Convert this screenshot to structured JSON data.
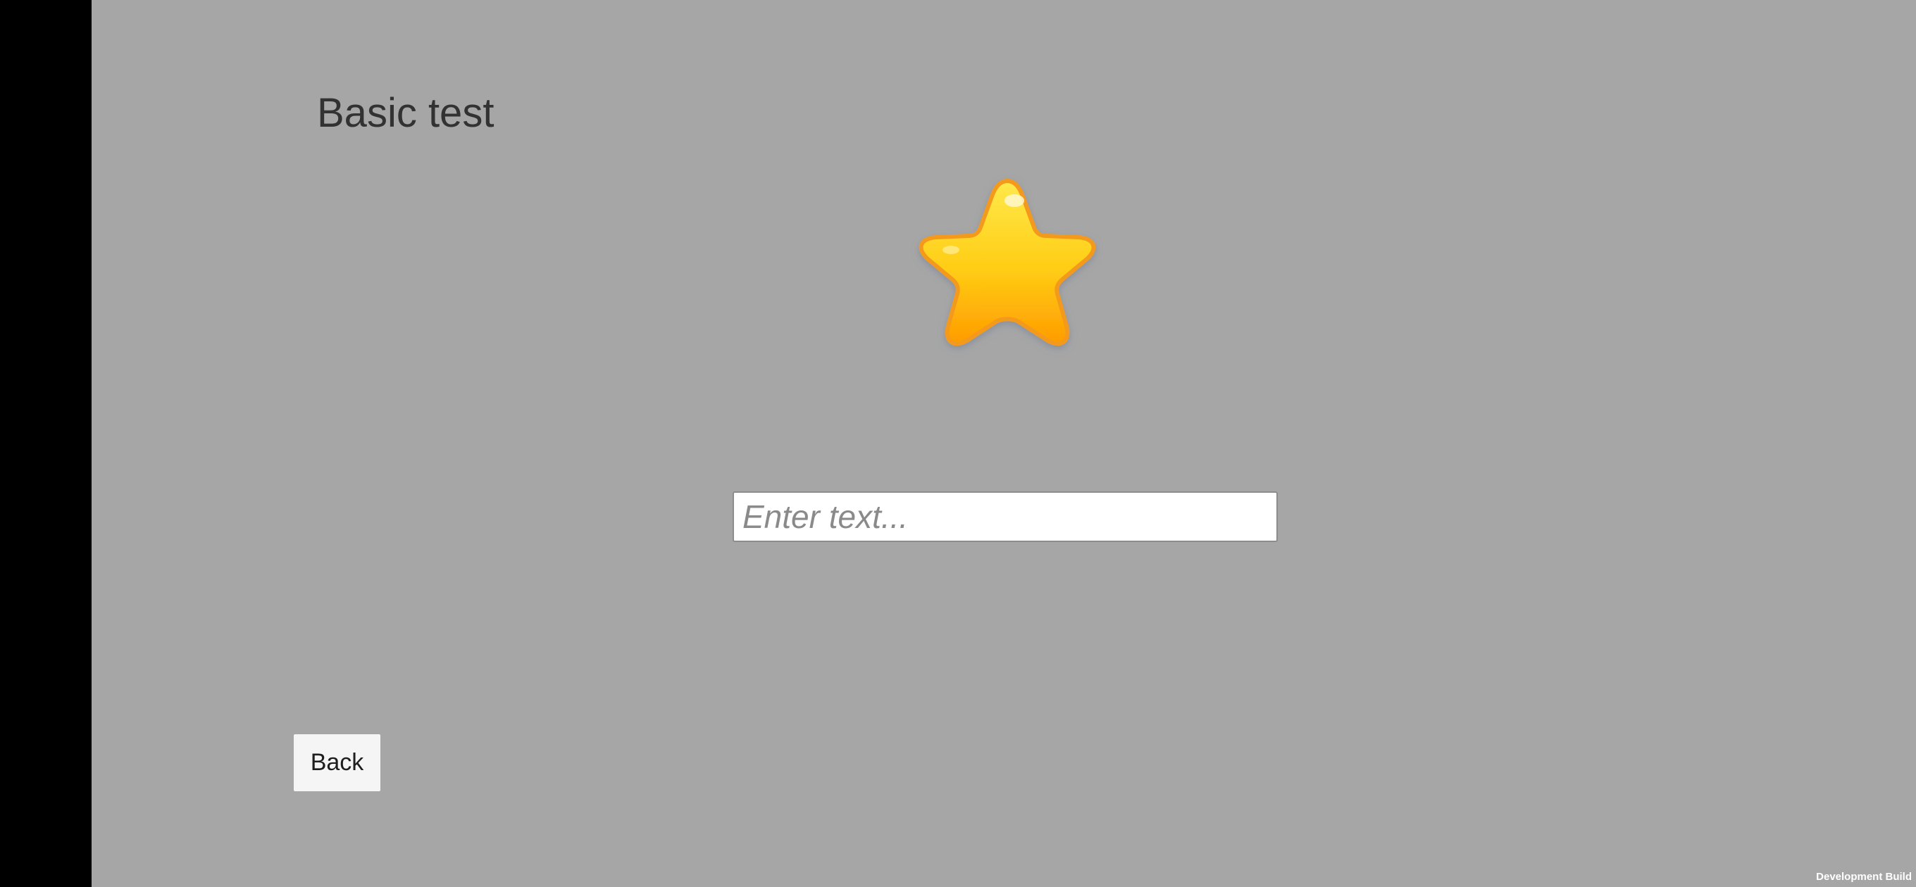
{
  "screen": {
    "title": "Basic test",
    "background_color": "#a6a6a6"
  },
  "star_image": {
    "icon": "star-icon",
    "color": "#ffc20a"
  },
  "input": {
    "value": "",
    "placeholder": "Enter text..."
  },
  "back_button": {
    "label": "Back"
  },
  "footer": {
    "watermark": "Development Build"
  }
}
